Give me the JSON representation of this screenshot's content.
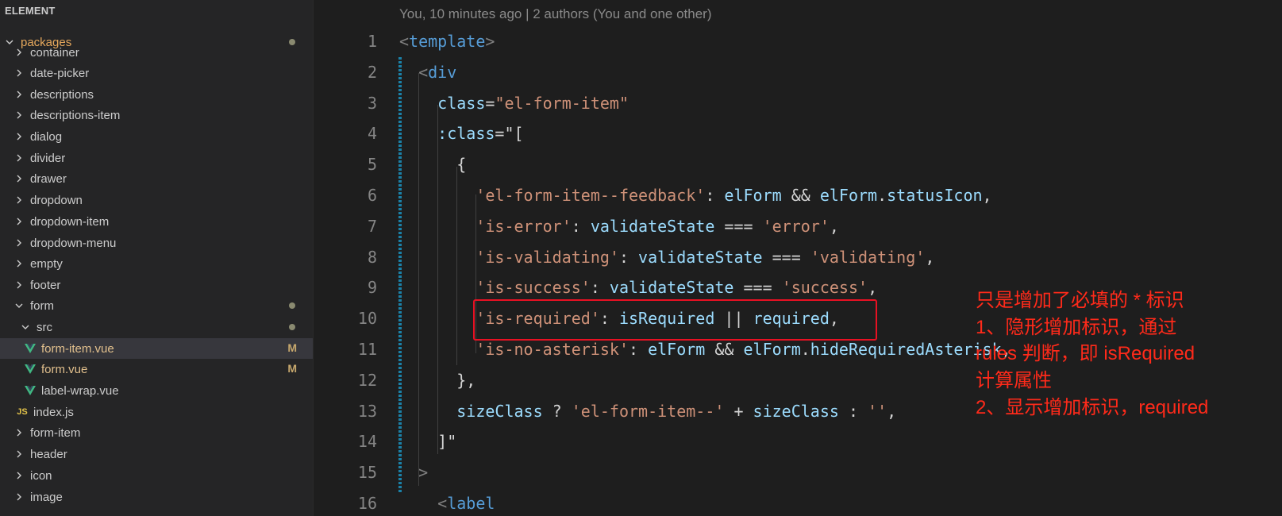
{
  "explorer": {
    "title": "ELEMENT",
    "items": [
      {
        "label": "packages",
        "kind": "folder",
        "expanded": true,
        "status": "dot",
        "color": "#e6a85c"
      },
      {
        "label": "container",
        "kind": "folder",
        "expanded": false
      },
      {
        "label": "date-picker",
        "kind": "folder",
        "expanded": false
      },
      {
        "label": "descriptions",
        "kind": "folder",
        "expanded": false
      },
      {
        "label": "descriptions-item",
        "kind": "folder",
        "expanded": false
      },
      {
        "label": "dialog",
        "kind": "folder",
        "expanded": false
      },
      {
        "label": "divider",
        "kind": "folder",
        "expanded": false
      },
      {
        "label": "drawer",
        "kind": "folder",
        "expanded": false
      },
      {
        "label": "dropdown",
        "kind": "folder",
        "expanded": false
      },
      {
        "label": "dropdown-item",
        "kind": "folder",
        "expanded": false
      },
      {
        "label": "dropdown-menu",
        "kind": "folder",
        "expanded": false
      },
      {
        "label": "empty",
        "kind": "folder",
        "expanded": false
      },
      {
        "label": "footer",
        "kind": "folder",
        "expanded": false
      },
      {
        "label": "form",
        "kind": "folder",
        "expanded": true,
        "status": "dot"
      },
      {
        "label": "src",
        "kind": "folder",
        "expanded": true,
        "status": "dot"
      },
      {
        "label": "form-item.vue",
        "kind": "vue",
        "status": "M",
        "selected": true
      },
      {
        "label": "form.vue",
        "kind": "vue",
        "status": "M"
      },
      {
        "label": "label-wrap.vue",
        "kind": "vue"
      },
      {
        "label": "index.js",
        "kind": "js",
        "icon": "JS"
      },
      {
        "label": "form-item",
        "kind": "folder",
        "expanded": false
      },
      {
        "label": "header",
        "kind": "folder",
        "expanded": false
      },
      {
        "label": "icon",
        "kind": "folder",
        "expanded": false
      },
      {
        "label": "image",
        "kind": "folder",
        "expanded": false
      }
    ]
  },
  "editor": {
    "blame": "You, 10 minutes ago | 2 authors (You and one other)",
    "line_numbers": [
      "1",
      "2",
      "3",
      "4",
      "5",
      "6",
      "7",
      "8",
      "9",
      "10",
      "11",
      "12",
      "13",
      "14",
      "15",
      "16"
    ],
    "lines": [
      [
        [
          "tk-br",
          "<"
        ],
        [
          "tk-tag",
          "template"
        ],
        [
          "tk-br",
          ">"
        ]
      ],
      [
        [
          "tk-op",
          "  "
        ],
        [
          "tk-br",
          "<"
        ],
        [
          "tk-tag",
          "div"
        ]
      ],
      [
        [
          "tk-op",
          "    "
        ],
        [
          "tk-attr",
          "class"
        ],
        [
          "tk-op",
          "="
        ],
        [
          "tk-str",
          "\"el-form-item\""
        ]
      ],
      [
        [
          "tk-op",
          "    "
        ],
        [
          "tk-attr",
          ":class"
        ],
        [
          "tk-op",
          "=\"["
        ]
      ],
      [
        [
          "tk-op",
          "      {"
        ]
      ],
      [
        [
          "tk-op",
          "        "
        ],
        [
          "tk-str",
          "'el-form-item--feedback'"
        ],
        [
          "tk-op",
          ": "
        ],
        [
          "tk-var",
          "elForm"
        ],
        [
          "tk-op",
          " && "
        ],
        [
          "tk-var",
          "elForm"
        ],
        [
          "tk-op",
          "."
        ],
        [
          "tk-var",
          "statusIcon"
        ],
        [
          "tk-op",
          ","
        ]
      ],
      [
        [
          "tk-op",
          "        "
        ],
        [
          "tk-str",
          "'is-error'"
        ],
        [
          "tk-op",
          ": "
        ],
        [
          "tk-var",
          "validateState"
        ],
        [
          "tk-op",
          " === "
        ],
        [
          "tk-str",
          "'error'"
        ],
        [
          "tk-op",
          ","
        ]
      ],
      [
        [
          "tk-op",
          "        "
        ],
        [
          "tk-str",
          "'is-validating'"
        ],
        [
          "tk-op",
          ": "
        ],
        [
          "tk-var",
          "validateState"
        ],
        [
          "tk-op",
          " === "
        ],
        [
          "tk-str",
          "'validating'"
        ],
        [
          "tk-op",
          ","
        ]
      ],
      [
        [
          "tk-op",
          "        "
        ],
        [
          "tk-str",
          "'is-success'"
        ],
        [
          "tk-op",
          ": "
        ],
        [
          "tk-var",
          "validateState"
        ],
        [
          "tk-op",
          " === "
        ],
        [
          "tk-str",
          "'success'"
        ],
        [
          "tk-op",
          ","
        ]
      ],
      [
        [
          "tk-op",
          "        "
        ],
        [
          "tk-str",
          "'is-required'"
        ],
        [
          "tk-op",
          ": "
        ],
        [
          "tk-var",
          "isRequired"
        ],
        [
          "tk-op",
          " || "
        ],
        [
          "tk-var",
          "required"
        ],
        [
          "tk-op",
          ","
        ]
      ],
      [
        [
          "tk-op",
          "        "
        ],
        [
          "tk-str",
          "'is-no-asterisk'"
        ],
        [
          "tk-op",
          ": "
        ],
        [
          "tk-var",
          "elForm"
        ],
        [
          "tk-op",
          " && "
        ],
        [
          "tk-var",
          "elForm"
        ],
        [
          "tk-op",
          "."
        ],
        [
          "tk-var",
          "hideRequiredAsterisk"
        ],
        [
          "tk-op",
          ","
        ]
      ],
      [
        [
          "tk-op",
          "      },"
        ]
      ],
      [
        [
          "tk-op",
          "      "
        ],
        [
          "tk-var",
          "sizeClass"
        ],
        [
          "tk-op",
          " ? "
        ],
        [
          "tk-str",
          "'el-form-item--'"
        ],
        [
          "tk-op",
          " + "
        ],
        [
          "tk-var",
          "sizeClass"
        ],
        [
          "tk-op",
          " : "
        ],
        [
          "tk-str",
          "''"
        ],
        [
          "tk-op",
          ","
        ]
      ],
      [
        [
          "tk-op",
          "    ]\""
        ]
      ],
      [
        [
          "tk-op",
          "  "
        ],
        [
          "tk-br",
          ">"
        ]
      ],
      [
        [
          "tk-op",
          "    "
        ],
        [
          "tk-br",
          "<"
        ],
        [
          "tk-tag",
          "label"
        ]
      ]
    ]
  },
  "annotation": {
    "lines": [
      "只是增加了必填的 * 标识",
      "1、隐形增加标识，通过",
      "rules 判断，即 isRequired",
      "计算属性",
      "2、显示增加标识，required"
    ],
    "color": "#ff2a1a"
  }
}
